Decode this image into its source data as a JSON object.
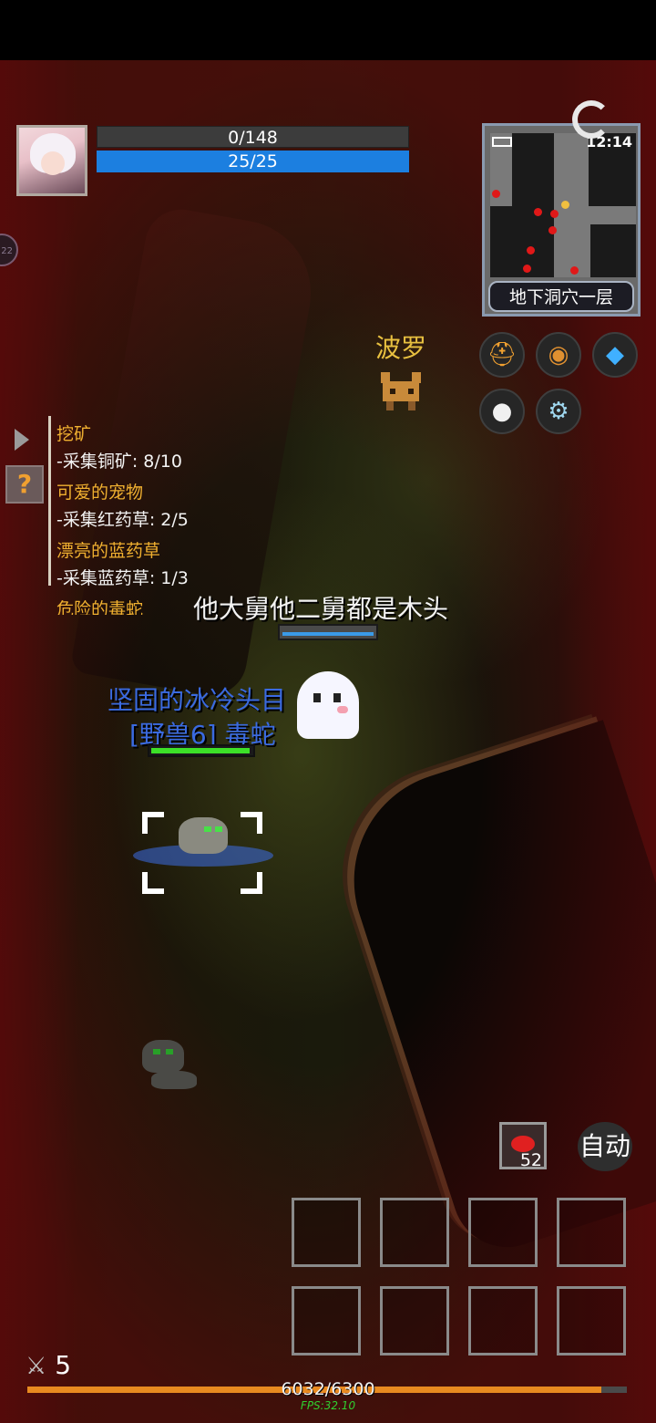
{
  "player": {
    "hp_text": "0/148",
    "mp_text": "25/25",
    "level": "5",
    "exp_text": "6032/6300",
    "exp_progress": 0.957
  },
  "side_badge": "22",
  "quests": [
    {
      "title": "挖矿",
      "task": "-采集铜矿: 8/10"
    },
    {
      "title": "可爱的宠物",
      "task": "-采集红药草: 2/5"
    },
    {
      "title": "漂亮的蓝药草",
      "task": "-采集蓝药草: 1/3"
    },
    {
      "title": "危险的毒蛇",
      "task": ""
    }
  ],
  "minimap": {
    "time": "12:14",
    "location": "地下洞穴一层"
  },
  "pet": {
    "name": "波罗"
  },
  "npc": {
    "name": "他大舅他二舅都是木头"
  },
  "target": {
    "title": "坚固的冰冷头目",
    "name": "[野兽6] 毒蛇"
  },
  "quick_item": {
    "count": "52"
  },
  "auto_button": "自动",
  "fps": "FPS:32.10",
  "colors": {
    "quest_title": "#f0b030",
    "mp_bar": "#1c7fe0",
    "boss_text": "#3a6ae0",
    "boss_hp": "#3ce028",
    "exp_bar": "#e88a20",
    "fps": "#30d030",
    "pet_name": "#e8c040"
  },
  "menu_icons": [
    "helmet-icon",
    "bag-icon",
    "crystal-icon",
    "penguin-icon",
    "gear-icon"
  ]
}
